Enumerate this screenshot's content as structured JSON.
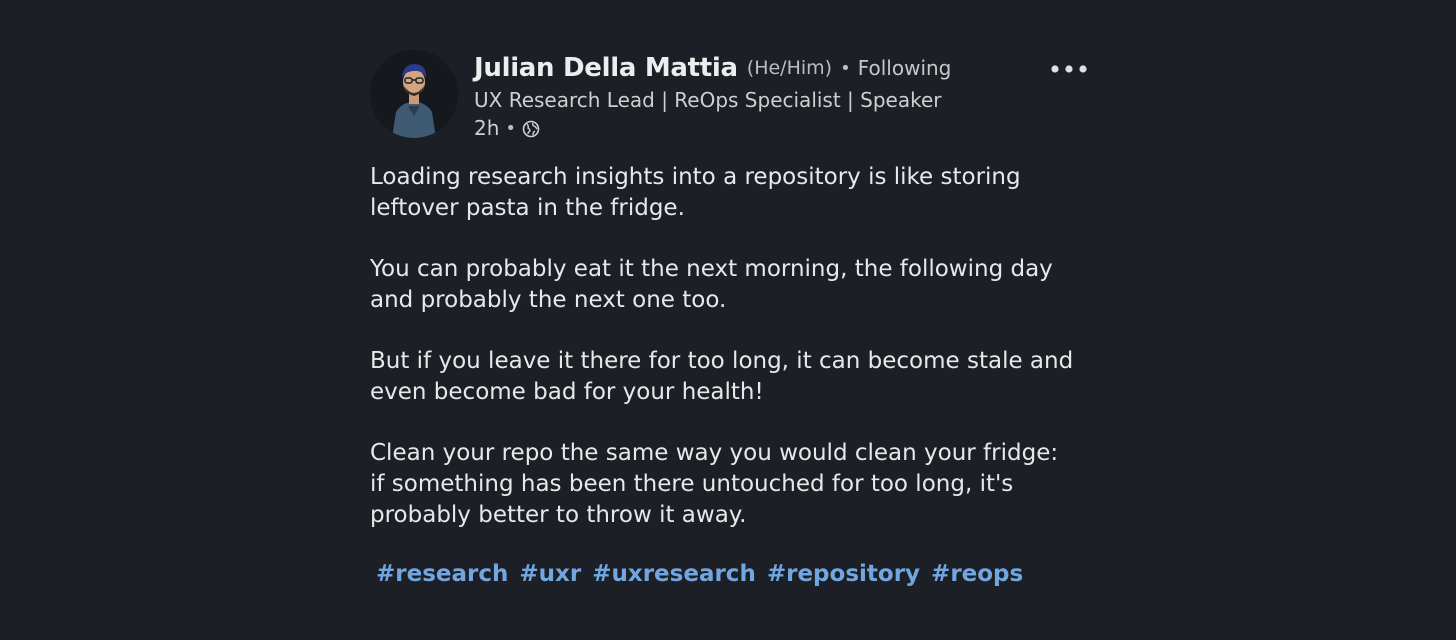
{
  "author": {
    "name": "Julian Della Mattia",
    "pronouns": "(He/Him)",
    "separator": "•",
    "follow_status": "Following",
    "headline": "UX Research Lead | ReOps Specialist | Speaker",
    "timestamp": "2h",
    "visibility_icon": "globe-icon",
    "avatar_icon": "profile-photo"
  },
  "menu": {
    "icon": "more-options-icon"
  },
  "post": {
    "paragraphs": [
      "Loading research insights into a repository is like storing\nleftover pasta in the fridge.",
      "You can probably eat it the next morning, the following day\nand probably the next one too.",
      "But if you leave it there for too long, it can become stale and\neven become bad for your health!",
      "Clean your repo the same way you would clean your fridge:\nif something has been there untouched for too long, it's\nprobably better to throw it away."
    ],
    "hashtags": [
      "#research",
      "#uxr",
      "#uxresearch",
      "#repository",
      "#reops"
    ]
  },
  "colors": {
    "background": "#1c1f26",
    "text": "#e8e8e8",
    "hashtag": "#71a6e0"
  }
}
